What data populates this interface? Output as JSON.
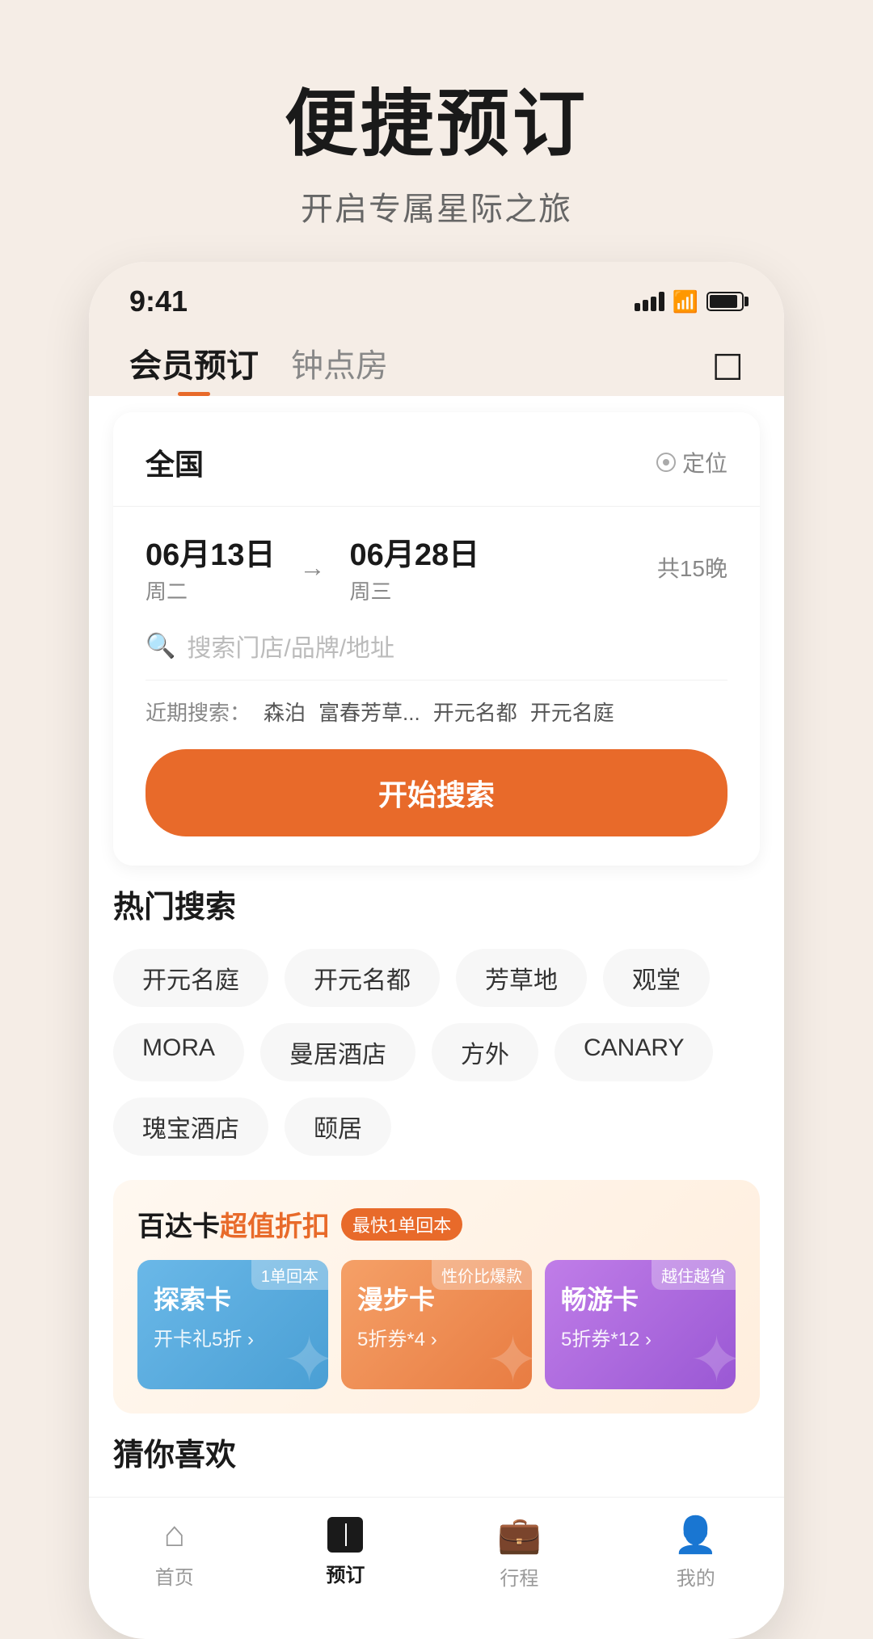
{
  "page": {
    "title": "便捷预订",
    "subtitle": "开启专属星际之旅"
  },
  "status_bar": {
    "time": "9:41"
  },
  "nav_tabs": {
    "active": "会员预订",
    "inactive": "钟点房"
  },
  "search_card": {
    "location": "全国",
    "location_btn": "定位",
    "date_start": "06月13日",
    "date_start_day": "周二",
    "date_arrow": "→",
    "date_end": "06月28日",
    "date_end_day": "周三",
    "nights": "共15晚",
    "search_placeholder": "搜索门店/品牌/地址",
    "recent_label": "近期搜索：",
    "recent_items": [
      "森泊",
      "富春芳草...",
      "开元名都",
      "开元名庭"
    ],
    "search_btn": "开始搜索"
  },
  "hot_search": {
    "title": "热门搜索",
    "tags": [
      "开元名庭",
      "开元名都",
      "芳草地",
      "观堂",
      "MORA",
      "曼居酒店",
      "方外",
      "CANARY",
      "瑰宝酒店",
      "颐居"
    ]
  },
  "baidaka": {
    "title": "百达卡",
    "title_highlight": "超值折扣",
    "badge": "最快1单回本",
    "cards": [
      {
        "tag": "1单回本",
        "name": "探索卡",
        "desc": "开卡礼5折 >",
        "color": "blue"
      },
      {
        "tag": "性价比爆款",
        "name": "漫步卡",
        "desc": "5折券*4 >",
        "color": "orange"
      },
      {
        "tag": "越住越省",
        "name": "畅游卡",
        "desc": "5折券*12 >",
        "color": "purple"
      }
    ]
  },
  "guess_section": {
    "title": "猜你喜欢"
  },
  "bottom_nav": {
    "items": [
      {
        "label": "首页",
        "active": false,
        "icon": "home"
      },
      {
        "label": "预订",
        "active": true,
        "icon": "book"
      },
      {
        "label": "行程",
        "active": false,
        "icon": "trip"
      },
      {
        "label": "我的",
        "active": false,
        "icon": "user"
      }
    ]
  }
}
